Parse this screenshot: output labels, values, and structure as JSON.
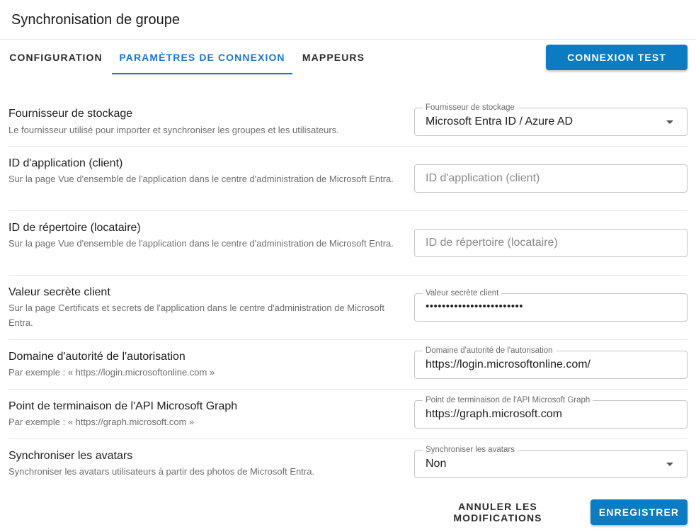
{
  "header": {
    "title": "Synchronisation de groupe"
  },
  "tabs": [
    {
      "label": "CONFIGURATION"
    },
    {
      "label": "PARAMÈTRES DE CONNEXION"
    },
    {
      "label": "MAPPEURS"
    }
  ],
  "toolbar": {
    "test_connection_label": "CONNEXION TEST"
  },
  "settings": {
    "storage_provider": {
      "title": "Fournisseur de stockage",
      "description": "Le fournisseur utilisé pour importer et synchroniser les groupes et les utilisateurs.",
      "field_label": "Fournisseur de stockage",
      "value": "Microsoft Entra ID / Azure AD"
    },
    "application_id": {
      "title": "ID d'application (client)",
      "description": "Sur la page Vue d'ensemble de l'application dans le centre d'administration de Microsoft Entra.",
      "placeholder": "ID d'application (client)"
    },
    "directory_id": {
      "title": "ID de répertoire (locataire)",
      "description": "Sur la page Vue d'ensemble de l'application dans le centre d'administration de Microsoft Entra.",
      "placeholder": "ID de répertoire (locataire)"
    },
    "client_secret": {
      "title": "Valeur secrète client",
      "description": "Sur la page Certificats et secrets de l'application dans le centre d'administration de Microsoft Entra.",
      "field_label": "Valeur secrète client",
      "value": "••••••••••••••••••••••••"
    },
    "authority_domain": {
      "title": "Domaine d'autorité de l'autorisation",
      "description": "Par exemple : « https://login.microsoftonline.com »",
      "field_label": "Domaine d'autorité de l'autorisation",
      "value": "https://login.microsoftonline.com/"
    },
    "graph_endpoint": {
      "title": "Point de terminaison de l'API Microsoft Graph",
      "description": "Par exemple : « https://graph.microsoft.com »",
      "field_label": "Point de terminaison de l'API Microsoft Graph",
      "value": "https://graph.microsoft.com"
    },
    "sync_avatars": {
      "title": "Synchroniser les avatars",
      "description": "Synchroniser les avatars utilisateurs à partir des photos de Microsoft Entra.",
      "field_label": "Synchroniser les avatars",
      "value": "Non"
    }
  },
  "footer": {
    "cancel_label": "ANNULER LES MODIFICATIONS",
    "save_label": "ENREGISTRER"
  },
  "colors": {
    "accent": "#1976d2",
    "primary_button": "#0b7bc2"
  }
}
